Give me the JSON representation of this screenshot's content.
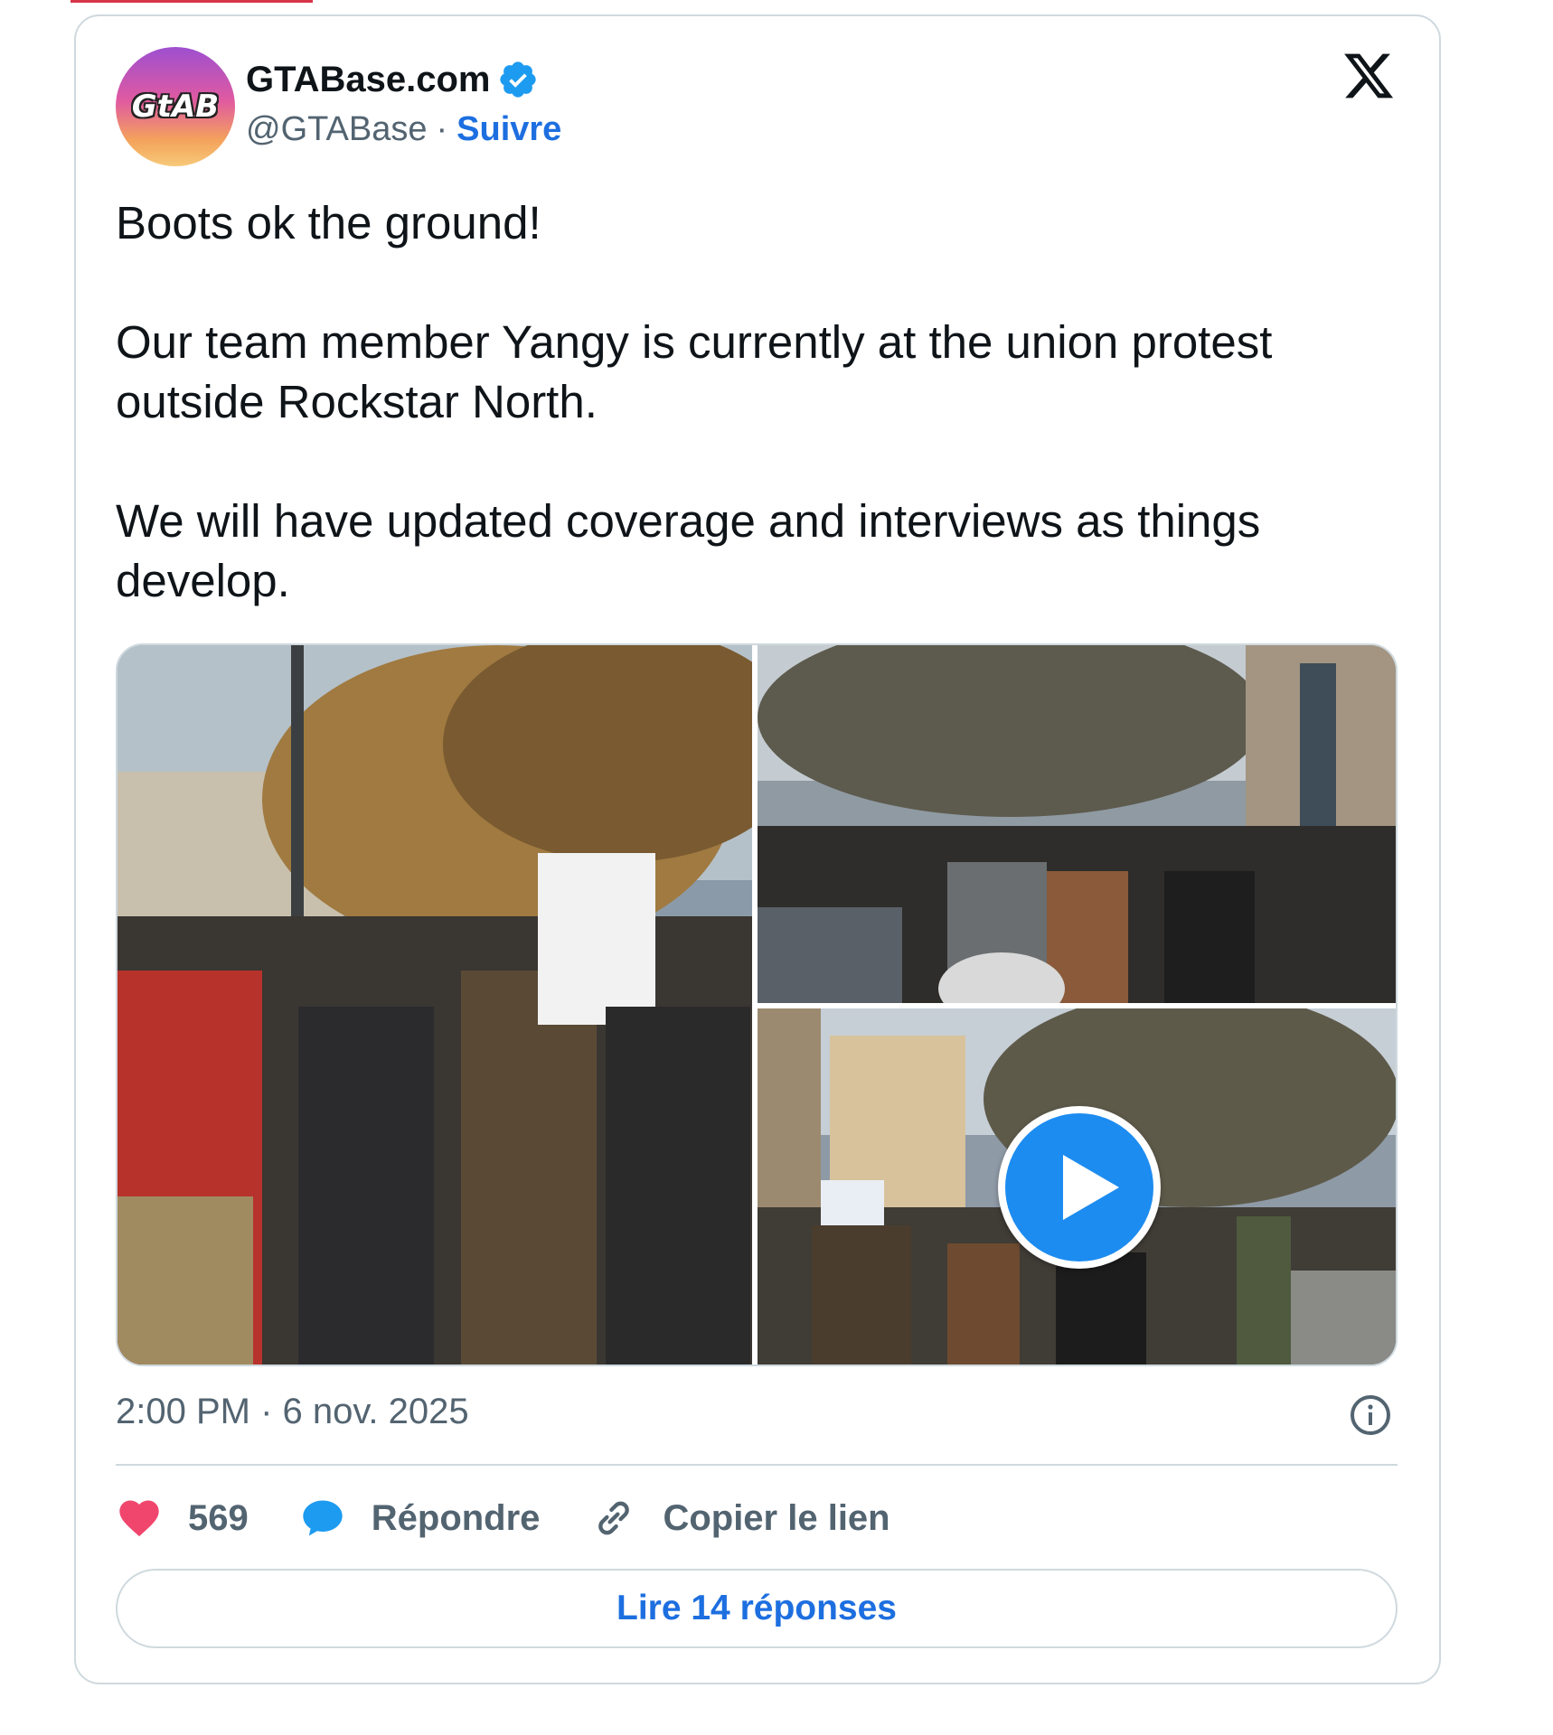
{
  "account": {
    "display_name": "GTABase.com",
    "handle": "@GTABase",
    "separator": "·",
    "follow_label": "Suivre",
    "avatar_text": "GtAB",
    "verified": true
  },
  "tweet": {
    "text_lines": [
      "Boots ok the ground!",
      "Our team member Yangy is currently at the union protest outside Rockstar North.",
      "We will have updated coverage and interviews as things develop."
    ],
    "timestamp": "2:00 PM · 6 nov. 2025"
  },
  "media": {
    "items": [
      "photo",
      "photo",
      "video"
    ]
  },
  "actions": {
    "likes": "569",
    "reply_label": "Répondre",
    "copy_link_label": "Copier le lien"
  },
  "read_replies_label": "Lire 14 réponses",
  "colors": {
    "link_blue": "#1d6fe0",
    "like_pink": "#f0466e",
    "reply_blue": "#1d9bf0",
    "muted_text": "#536471",
    "border": "#cfd9de"
  },
  "icons": {
    "brand": "x-logo-icon",
    "verified": "verified-badge-icon",
    "info": "info-icon",
    "like": "heart-icon",
    "reply": "speech-bubble-icon",
    "copy": "link-icon",
    "play": "play-icon"
  }
}
